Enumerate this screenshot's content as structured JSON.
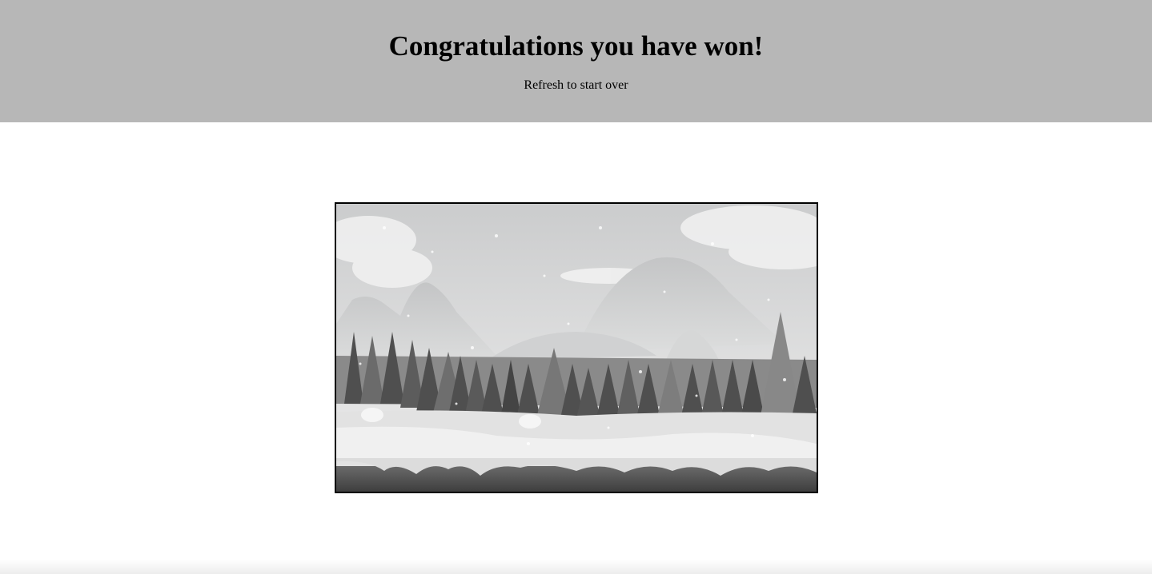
{
  "banner": {
    "title": "Congratulations you have won!",
    "subtitle": "Refresh to start over"
  },
  "scene": {
    "description_icon": "winter-landscape-image",
    "palette": {
      "sky": "#d7d8d9",
      "mountain_far": "#cfd0d1",
      "mountain_near": "#bfc0c1",
      "trees_dark": "#4d4d4d",
      "trees_light": "#8e8e8e",
      "snow": "#ececec",
      "ground_dark": "#5e5e5e"
    }
  }
}
